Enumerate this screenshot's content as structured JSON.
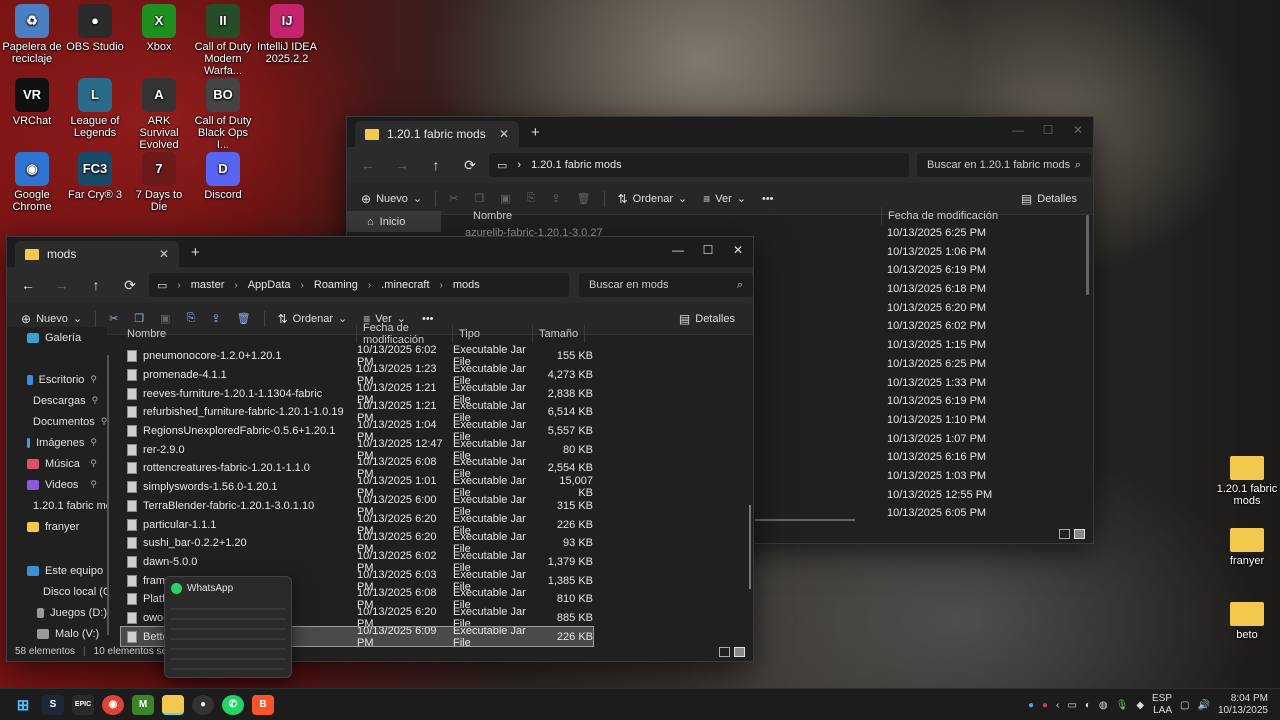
{
  "desktop": {
    "icons": [
      {
        "label": "Papelera de reciclaje",
        "color": "#4a7fc0",
        "glyph": "♻"
      },
      {
        "label": "OBS Studio",
        "color": "#2b2b2b",
        "glyph": "●"
      },
      {
        "label": "Xbox",
        "color": "#1f8f1f",
        "glyph": "X"
      },
      {
        "label": "Call of Duty Modern Warfa...",
        "color": "#264d26",
        "glyph": "II"
      },
      {
        "label": "IntelliJ IDEA 2025.2.2",
        "color": "#c4246b",
        "glyph": "IJ"
      },
      {
        "label": "VRChat",
        "color": "#111111",
        "glyph": "VR"
      },
      {
        "label": "League of Legends",
        "color": "#2a6b8a",
        "glyph": "L"
      },
      {
        "label": "ARK Survival Evolved",
        "color": "#333333",
        "glyph": "A"
      },
      {
        "label": "Call of Duty Black Ops I...",
        "color": "#444444",
        "glyph": "BO"
      },
      {
        "label": "Google Chrome",
        "color": "#2f74d0",
        "glyph": "◉"
      },
      {
        "label": "Far Cry® 3",
        "color": "#1a4a6a",
        "glyph": "FC3"
      },
      {
        "label": "7 Days to Die",
        "color": "#6a1a1a",
        "glyph": "7"
      },
      {
        "label": "Discord",
        "color": "#5865f2",
        "glyph": "D"
      },
      {
        "label": "1.20.1 fabric mods",
        "color": "#f2c94c",
        "glyph": ""
      },
      {
        "label": "franyer",
        "color": "#f2c94c",
        "glyph": ""
      },
      {
        "label": "beto",
        "color": "#f2c94c",
        "glyph": ""
      }
    ]
  },
  "back_window": {
    "tab_title": "1.20.1 fabric mods",
    "breadcrumb": "1.20.1 fabric mods",
    "search_placeholder": "Buscar en 1.20.1 fabric mods",
    "cmd": {
      "new": "Nuevo",
      "sort": "Ordenar",
      "view": "Ver",
      "details": "Detalles"
    },
    "nav_home": "Inicio",
    "col_name": "Nombre",
    "col_date": "Fecha de modificación",
    "first_file": "azurelib-fabric-1.20.1-3.0.27",
    "dates": [
      "10/13/2025 6:25 PM",
      "10/13/2025 1:06 PM",
      "10/13/2025 6:19 PM",
      "10/13/2025 6:18 PM",
      "10/13/2025 6:20 PM",
      "10/13/2025 6:02 PM",
      "10/13/2025 1:15 PM",
      "10/13/2025 6:25 PM",
      "10/13/2025 1:33 PM",
      "10/13/2025 6:19 PM",
      "10/13/2025 1:10 PM",
      "10/13/2025 1:07 PM",
      "10/13/2025 6:16 PM",
      "10/13/2025 1:03 PM",
      "10/13/2025 12:55 PM",
      "10/13/2025 6:05 PM"
    ]
  },
  "front_window": {
    "tab_title": "mods",
    "breadcrumbs": [
      "master",
      "AppData",
      "Roaming",
      ".minecraft",
      "mods"
    ],
    "search_placeholder": "Buscar en mods",
    "cmd": {
      "new": "Nuevo",
      "sort": "Ordenar",
      "view": "Ver",
      "details": "Detalles"
    },
    "nav": [
      {
        "label": "Galería",
        "color": "#3aa0d8",
        "pin": ""
      },
      {
        "label": "Escritorio",
        "color": "#3a8fd8",
        "pin": "📌"
      },
      {
        "label": "Descargas",
        "color": "#3ab07a",
        "pin": "📌"
      },
      {
        "label": "Documentos",
        "color": "#8a8a9a",
        "pin": "📌"
      },
      {
        "label": "Imágenes",
        "color": "#4a9ad8",
        "pin": "📌"
      },
      {
        "label": "Música",
        "color": "#e0506a",
        "pin": "📌"
      },
      {
        "label": "Videos",
        "color": "#8a5ad8",
        "pin": "📌"
      },
      {
        "label": "1.20.1 fabric mo",
        "color": "#f2c94c",
        "pin": ""
      },
      {
        "label": "franyer",
        "color": "#f2c94c",
        "pin": ""
      },
      {
        "label": "Este equipo",
        "color": "#3a8fd8",
        "pin": ""
      },
      {
        "label": "Disco local (C:",
        "color": "#9a9a9a",
        "pin": ""
      },
      {
        "label": "Juegos (D:)",
        "color": "#9a9a9a",
        "pin": ""
      },
      {
        "label": "Malo (V:)",
        "color": "#9a9a9a",
        "pin": ""
      }
    ],
    "columns": {
      "name": "Nombre",
      "date": "Fecha de modificación",
      "type": "Tipo",
      "size": "Tamaño"
    },
    "files": [
      {
        "name": "pneumonocore-1.2.0+1.20.1",
        "date": "10/13/2025 6:02 PM",
        "type": "Executable Jar File",
        "size": "155 KB"
      },
      {
        "name": "promenade-4.1.1",
        "date": "10/13/2025 1:23 PM",
        "type": "Executable Jar File",
        "size": "4,273 KB"
      },
      {
        "name": "reeves-furniture-1.20.1-1.1304-fabric",
        "date": "10/13/2025 1:21 PM",
        "type": "Executable Jar File",
        "size": "2,838 KB"
      },
      {
        "name": "refurbished_furniture-fabric-1.20.1-1.0.19",
        "date": "10/13/2025 1:21 PM",
        "type": "Executable Jar File",
        "size": "6,514 KB"
      },
      {
        "name": "RegionsUnexploredFabric-0.5.6+1.20.1",
        "date": "10/13/2025 1:04 PM",
        "type": "Executable Jar File",
        "size": "5,557 KB"
      },
      {
        "name": "rer-2.9.0",
        "date": "10/13/2025 12:47 PM",
        "type": "Executable Jar File",
        "size": "80 KB"
      },
      {
        "name": "rottencreatures-fabric-1.20.1-1.1.0",
        "date": "10/13/2025 6:08 PM",
        "type": "Executable Jar File",
        "size": "2,554 KB"
      },
      {
        "name": "simplyswords-1.56.0-1.20.1",
        "date": "10/13/2025 1:01 PM",
        "type": "Executable Jar File",
        "size": "15,007 KB"
      },
      {
        "name": "TerraBlender-fabric-1.20.1-3.0.1.10",
        "date": "10/13/2025 6:00 PM",
        "type": "Executable Jar File",
        "size": "315 KB"
      },
      {
        "name": "particular-1.1.1",
        "date": "10/13/2025 6:20 PM",
        "type": "Executable Jar File",
        "size": "226 KB"
      },
      {
        "name": "sushi_bar-0.2.2+1.20",
        "date": "10/13/2025 6:20 PM",
        "type": "Executable Jar File",
        "size": "93 KB"
      },
      {
        "name": "dawn-5.0.0",
        "date": "10/13/2025 6:02 PM",
        "type": "Executable Jar File",
        "size": "1,379 KB"
      },
      {
        "name": "framew",
        "date": "10/13/2025 6:03 PM",
        "type": "Executable Jar File",
        "size": "1,385 KB"
      },
      {
        "name": "Platfor",
        "date": "10/13/2025 6:08 PM",
        "type": "Executable Jar File",
        "size": "810 KB"
      },
      {
        "name": "owo-lib",
        "date": "10/13/2025 6:20 PM",
        "type": "Executable Jar File",
        "size": "885 KB"
      },
      {
        "name": "BetterN",
        "date": "10/13/2025 6:09 PM",
        "type": "Executable Jar File",
        "size": "226 KB"
      }
    ],
    "status_count": "58 elementos",
    "status_selected": "10 elementos selecciona"
  },
  "whatsapp_preview": {
    "title": "WhatsApp"
  },
  "taskbar": {
    "lang": "ESP",
    "lang2": "LAA",
    "time": "8:04 PM",
    "date": "10/13/2025"
  }
}
